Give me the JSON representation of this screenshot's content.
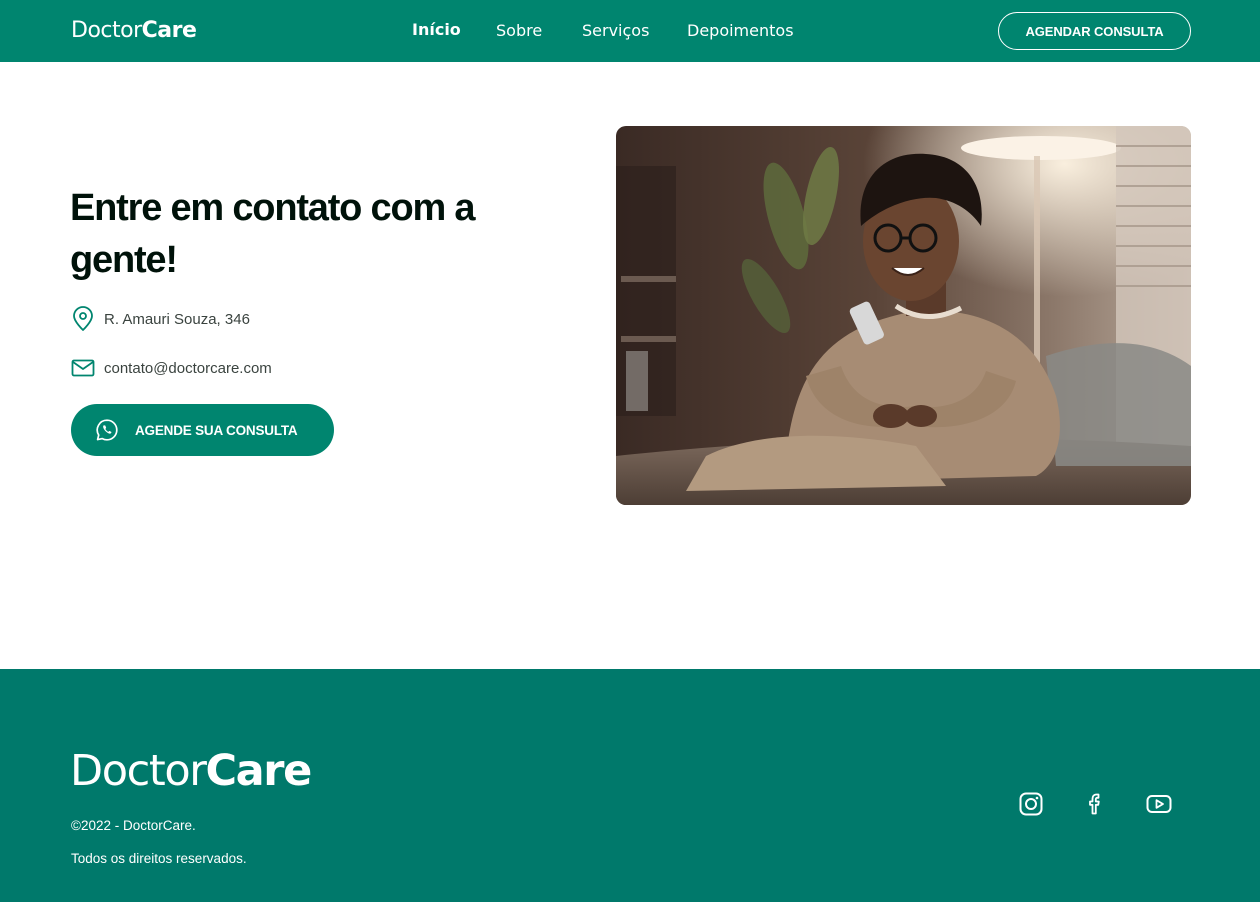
{
  "header": {
    "logo_light": "Doctor",
    "logo_bold": "Care",
    "nav": [
      {
        "label": "Início",
        "active": true
      },
      {
        "label": "Sobre",
        "active": false
      },
      {
        "label": "Serviços",
        "active": false
      },
      {
        "label": "Depoimentos",
        "active": false
      }
    ],
    "cta_label": "AGENDAR CONSULTA"
  },
  "contact": {
    "title": "Entre em contato com a gente!",
    "address": "R. Amauri Souza, 346",
    "email": "contato@doctorcare.com",
    "cta_label": "AGENDE SUA CONSULTA",
    "icons": [
      "location-pin-icon",
      "mail-icon",
      "whatsapp-icon"
    ]
  },
  "footer": {
    "logo_light": "Doctor",
    "logo_bold": "Care",
    "copyright": "©2022 - DoctorCare.",
    "rights": "Todos os direitos reservados.",
    "social": [
      "instagram-icon",
      "facebook-icon",
      "youtube-icon"
    ]
  },
  "colors": {
    "brand": "#00856f",
    "footer_bg": "#00796b",
    "heading": "#00120a",
    "text": "#3a433f",
    "white": "#ffffff"
  }
}
